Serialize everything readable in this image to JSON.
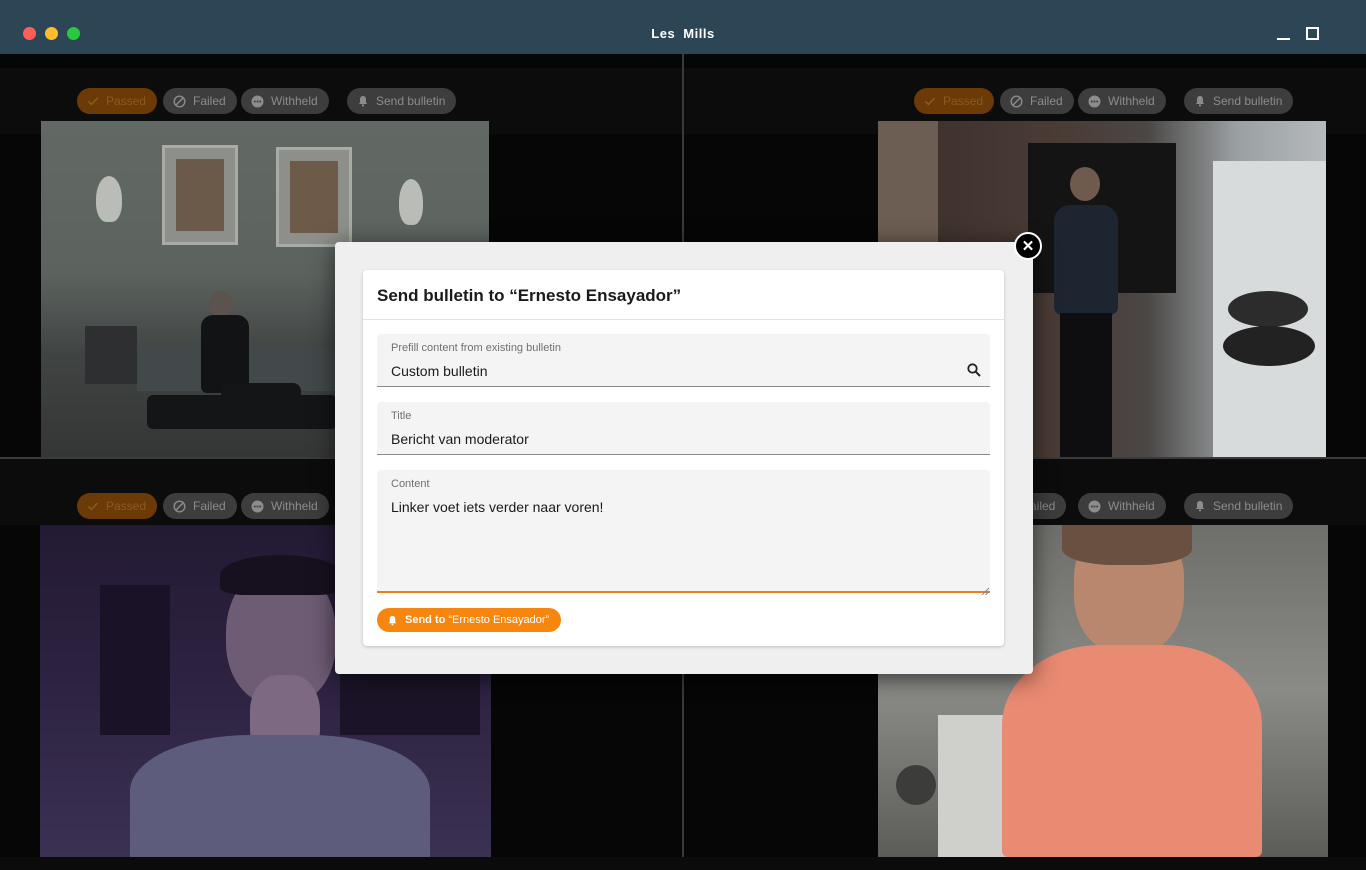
{
  "window": {
    "title": "Les  Mills"
  },
  "tile_controls": {
    "passed": "Passed",
    "failed": "Failed",
    "withheld": "Withheld",
    "send_bulletin": "Send bulletin",
    "failed_partial": "ailed"
  },
  "modal": {
    "close_glyph": "✕",
    "title": "Send bulletin to “Ernesto Ensayador”",
    "prefill": {
      "label": "Prefill content from existing bulletin",
      "value": "Custom bulletin"
    },
    "title_field": {
      "label": "Title",
      "value": "Bericht van moderator"
    },
    "content_field": {
      "label": "Content",
      "value": "Linker voet iets verder naar voren!"
    },
    "send_button": {
      "prefix": "Send to",
      "target": "“Ernesto Ensayador”"
    }
  },
  "colors": {
    "titlebar": "#2c4656",
    "accent": "#f7860f",
    "chip_bg": "#3d3d3d",
    "passed_chip_bg": "#6b3a06"
  }
}
